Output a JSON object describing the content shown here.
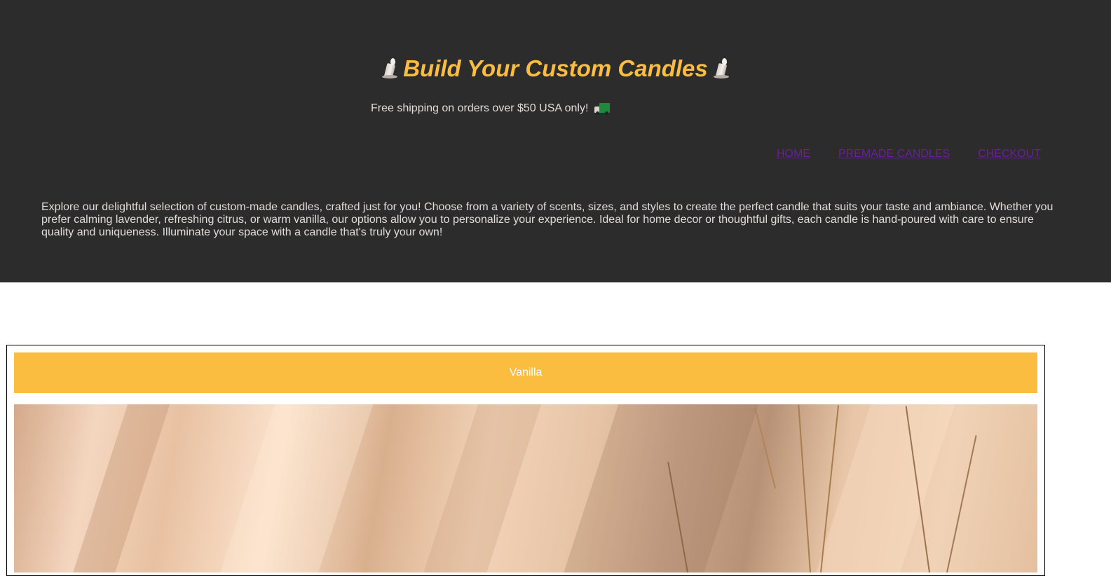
{
  "header": {
    "title": "Build Your Custom Candles",
    "title_icon": "candle-icon",
    "shipping_text": "Free shipping on orders over $50 USA only!",
    "shipping_icon": "delivery-truck-icon",
    "description": "Explore our delightful selection of custom-made candles, crafted just for you! Choose from a variety of scents, sizes, and styles to create the perfect candle that suits your taste and ambiance. Whether you prefer calming lavender, refreshing citrus, or warm vanilla, our options allow you to personalize your experience. Ideal for home decor or thoughtful gifts, each candle is hand-poured with care to ensure quality and uniqueness. Illuminate your space with a candle that's truly your own!"
  },
  "nav": {
    "home": "HOME",
    "premade": "PREMADE CANDLES",
    "checkout": "CHECKOUT"
  },
  "product": {
    "scent_label": "Vanilla"
  },
  "colors": {
    "header_bg": "#2c2c2c",
    "accent": "#fbbd3f",
    "nav_link": "#6a1f9b",
    "header_text": "#e3dada"
  }
}
